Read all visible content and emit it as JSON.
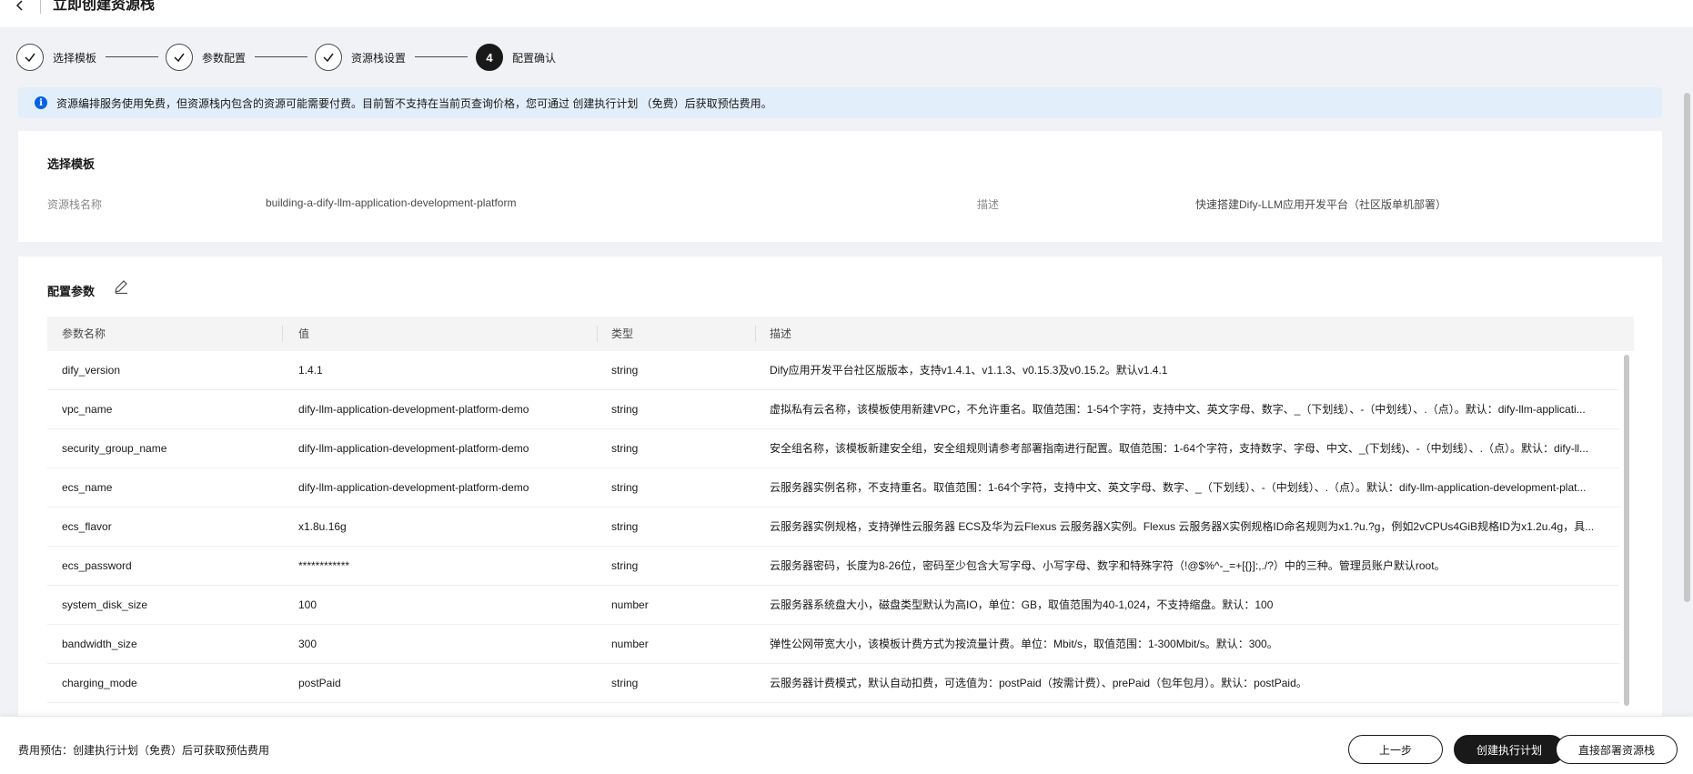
{
  "header": {
    "title": "立即创建资源栈"
  },
  "steps": [
    {
      "label": "选择模板",
      "state": "done"
    },
    {
      "label": "参数配置",
      "state": "done"
    },
    {
      "label": "资源栈设置",
      "state": "done"
    },
    {
      "label": "配置确认",
      "state": "active",
      "number": "4"
    }
  ],
  "banner": {
    "text": "资源编排服务使用免费，但资源栈内包含的资源可能需要付费。目前暂不支持在当前页查询价格，您可通过 创建执行计划 （免费）后获取预估费用。"
  },
  "template_section": {
    "title": "选择模板",
    "stack_name_label": "资源栈名称",
    "stack_name_value": "building-a-dify-llm-application-development-platform",
    "desc_label": "描述",
    "desc_value": "快速搭建Dify-LLM应用开发平台（社区版单机部署）"
  },
  "params_section": {
    "title": "配置参数",
    "columns": [
      "参数名称",
      "值",
      "类型",
      "描述"
    ],
    "rows": [
      {
        "name": "dify_version",
        "value": "1.4.1",
        "type": "string",
        "desc": "Dify应用开发平台社区版版本，支持v1.4.1、v1.1.3、v0.15.3及v0.15.2。默认v1.4.1"
      },
      {
        "name": "vpc_name",
        "value": "dify-llm-application-development-platform-demo",
        "type": "string",
        "desc": "虚拟私有云名称，该模板使用新建VPC，不允许重名。取值范围：1-54个字符，支持中文、英文字母、数字、_（下划线）、-（中划线）、.（点）。默认：dify-llm-applicati..."
      },
      {
        "name": "security_group_name",
        "value": "dify-llm-application-development-platform-demo",
        "type": "string",
        "desc": "安全组名称，该模板新建安全组，安全组规则请参考部署指南进行配置。取值范围：1-64个字符，支持数字、字母、中文、_(下划线)、-（中划线）、.（点）。默认：dify-ll..."
      },
      {
        "name": "ecs_name",
        "value": "dify-llm-application-development-platform-demo",
        "type": "string",
        "desc": "云服务器实例名称，不支持重名。取值范围：1-64个字符，支持中文、英文字母、数字、_（下划线）、-（中划线）、.（点）。默认：dify-llm-application-development-plat..."
      },
      {
        "name": "ecs_flavor",
        "value": "x1.8u.16g",
        "type": "string",
        "desc": "云服务器实例规格，支持弹性云服务器 ECS及华为云Flexus 云服务器X实例。Flexus 云服务器X实例规格ID命名规则为x1.?u.?g，例如2vCPUs4GiB规格ID为x1.2u.4g，具..."
      },
      {
        "name": "ecs_password",
        "value": "************",
        "type": "string",
        "desc": "云服务器密码，长度为8-26位，密码至少包含大写字母、小写字母、数字和特殊字符（!@$%^-_=+[{}]:,./?）中的三种。管理员账户默认root。"
      },
      {
        "name": "system_disk_size",
        "value": "100",
        "type": "number",
        "desc": "云服务器系统盘大小，磁盘类型默认为高IO，单位：GB，取值范围为40-1,024，不支持缩盘。默认：100"
      },
      {
        "name": "bandwidth_size",
        "value": "300",
        "type": "number",
        "desc": "弹性公网带宽大小，该模板计费方式为按流量计费。单位：Mbit/s，取值范围：1-300Mbit/s。默认：300。"
      },
      {
        "name": "charging_mode",
        "value": "postPaid",
        "type": "string",
        "desc": "云服务器计费模式，默认自动扣费，可选值为：postPaid（按需计费）、prePaid（包年包月）。默认：postPaid。"
      }
    ]
  },
  "footer": {
    "cost_text": "费用预估：创建执行计划（免费）后可获取预估费用",
    "prev_label": "上一步",
    "create_plan_label": "创建执行计划",
    "deploy_label": "直接部署资源栈"
  }
}
